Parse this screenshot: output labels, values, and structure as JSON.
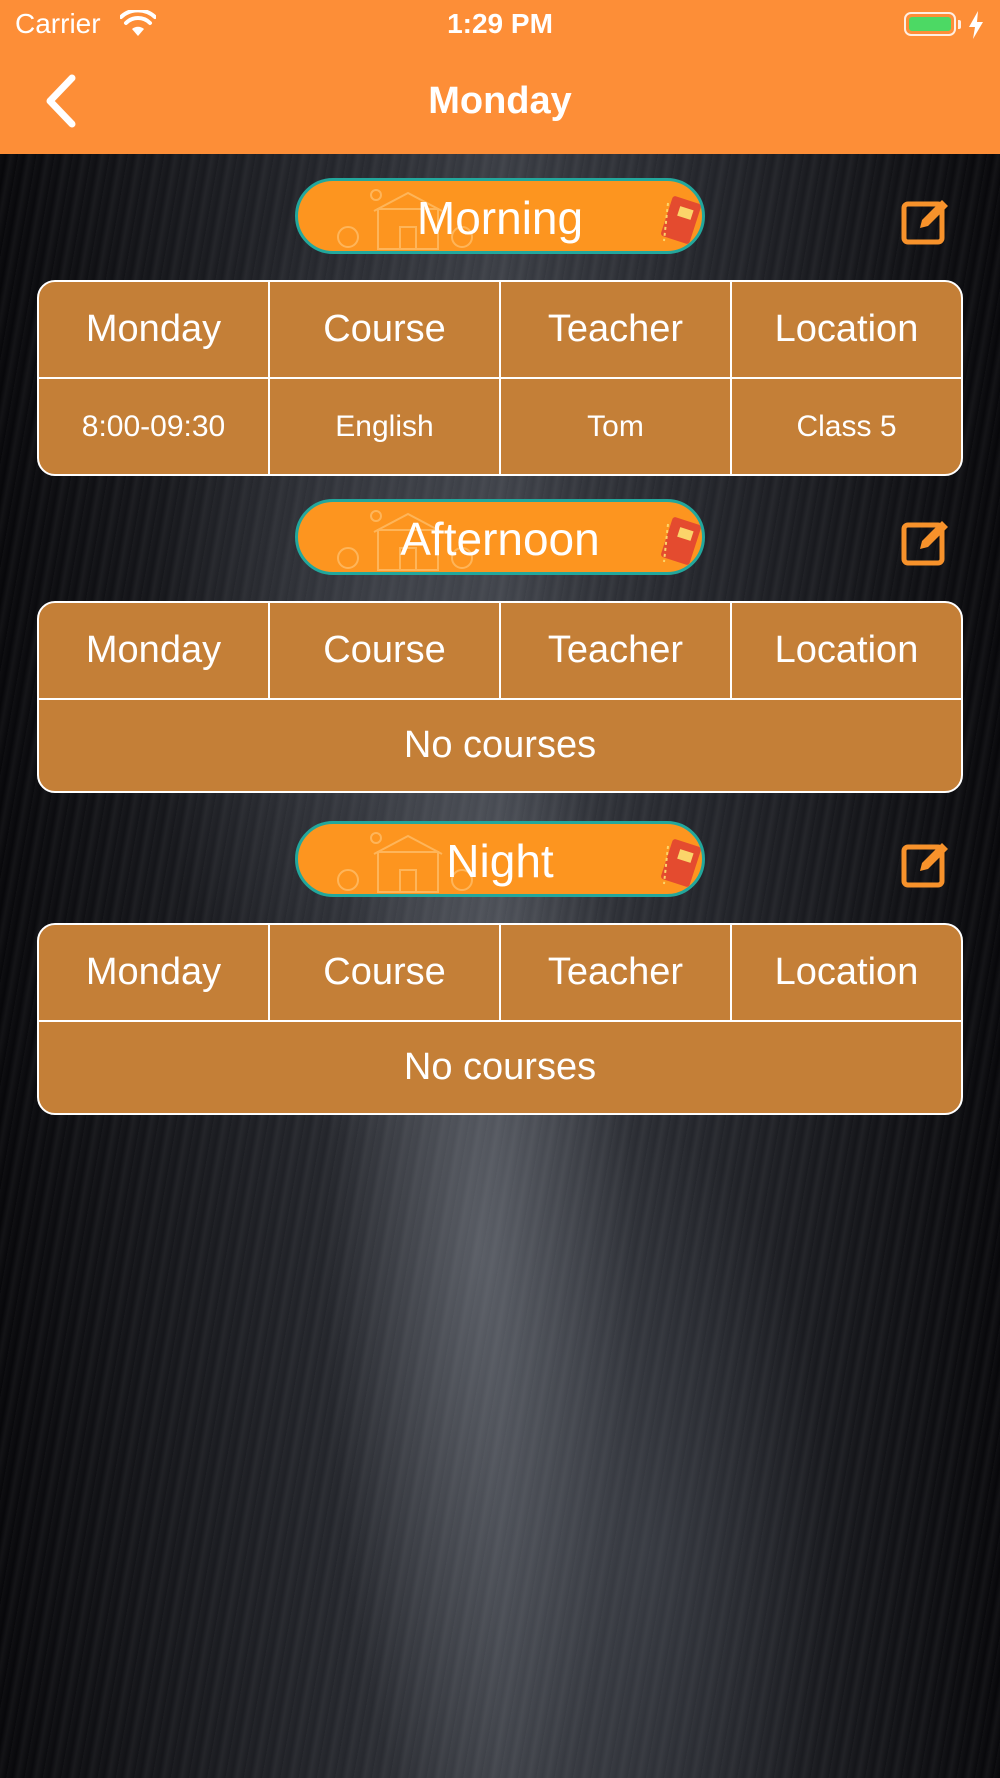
{
  "status_bar": {
    "carrier": "Carrier",
    "time": "1:29 PM"
  },
  "nav": {
    "title": "Monday",
    "back_icon": "chevron-left-icon"
  },
  "colors": {
    "accent": "#fd8e37",
    "pill": "#fd951f",
    "pill_border": "#22a79c",
    "table": "#c47f37"
  },
  "sections": [
    {
      "title": "Morning",
      "headers": [
        "Monday",
        "Course",
        "Teacher",
        "Location"
      ],
      "rows": [
        [
          "8:00-09:30",
          "English",
          "Tom",
          "Class 5"
        ]
      ],
      "empty_text": ""
    },
    {
      "title": "Afternoon",
      "headers": [
        "Monday",
        "Course",
        "Teacher",
        "Location"
      ],
      "rows": [],
      "empty_text": "No courses"
    },
    {
      "title": "Night",
      "headers": [
        "Monday",
        "Course",
        "Teacher",
        "Location"
      ],
      "rows": [],
      "empty_text": "No courses"
    }
  ]
}
